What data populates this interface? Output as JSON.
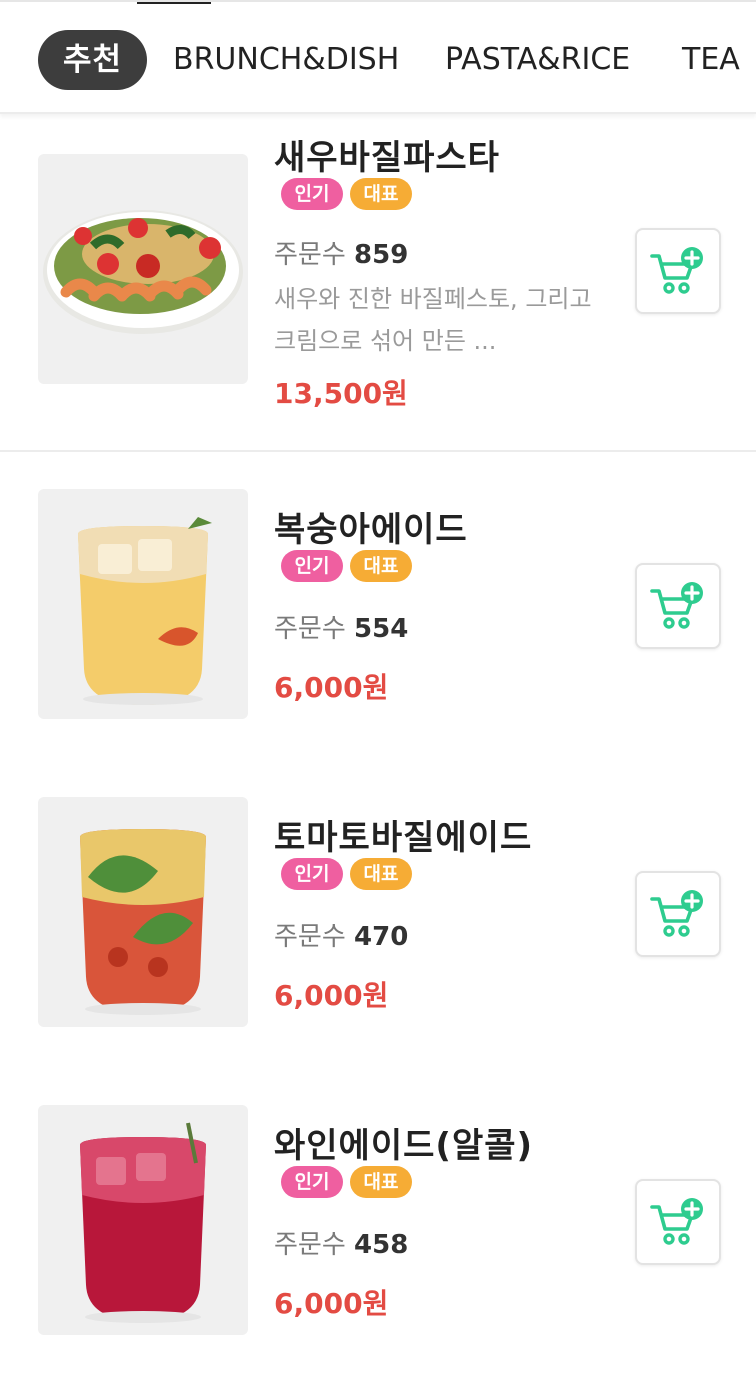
{
  "tabs": [
    {
      "label": "추천",
      "active": true
    },
    {
      "label": "BRUNCH&DISH",
      "active": false
    },
    {
      "label": "PASTA&RICE",
      "active": false
    },
    {
      "label": "TEA",
      "active": false
    }
  ],
  "badges": {
    "popular": "인기",
    "signature": "대표"
  },
  "order_count_label": "주문수",
  "items": [
    {
      "name": "새우바질파스타",
      "order_count": "859",
      "description": "새우와 진한 바질페스토, 그리고 크림으로 섞어 만든 ...",
      "price": "13,500원"
    },
    {
      "name": "복숭아에이드",
      "order_count": "554",
      "description": "",
      "price": "6,000원"
    },
    {
      "name": "토마토바질에이드",
      "order_count": "470",
      "description": "",
      "price": "6,000원"
    },
    {
      "name": "와인에이드(알콜)",
      "order_count": "458",
      "description": "",
      "price": "6,000원"
    }
  ],
  "colors": {
    "accent_price": "#e34b43",
    "badge_popular": "#ef5fa0",
    "badge_signature": "#f6ac35",
    "cart_icon": "#2ecc8f",
    "active_tab": "#3d3d3d"
  },
  "icons": {
    "cart": "add-to-cart-icon"
  }
}
